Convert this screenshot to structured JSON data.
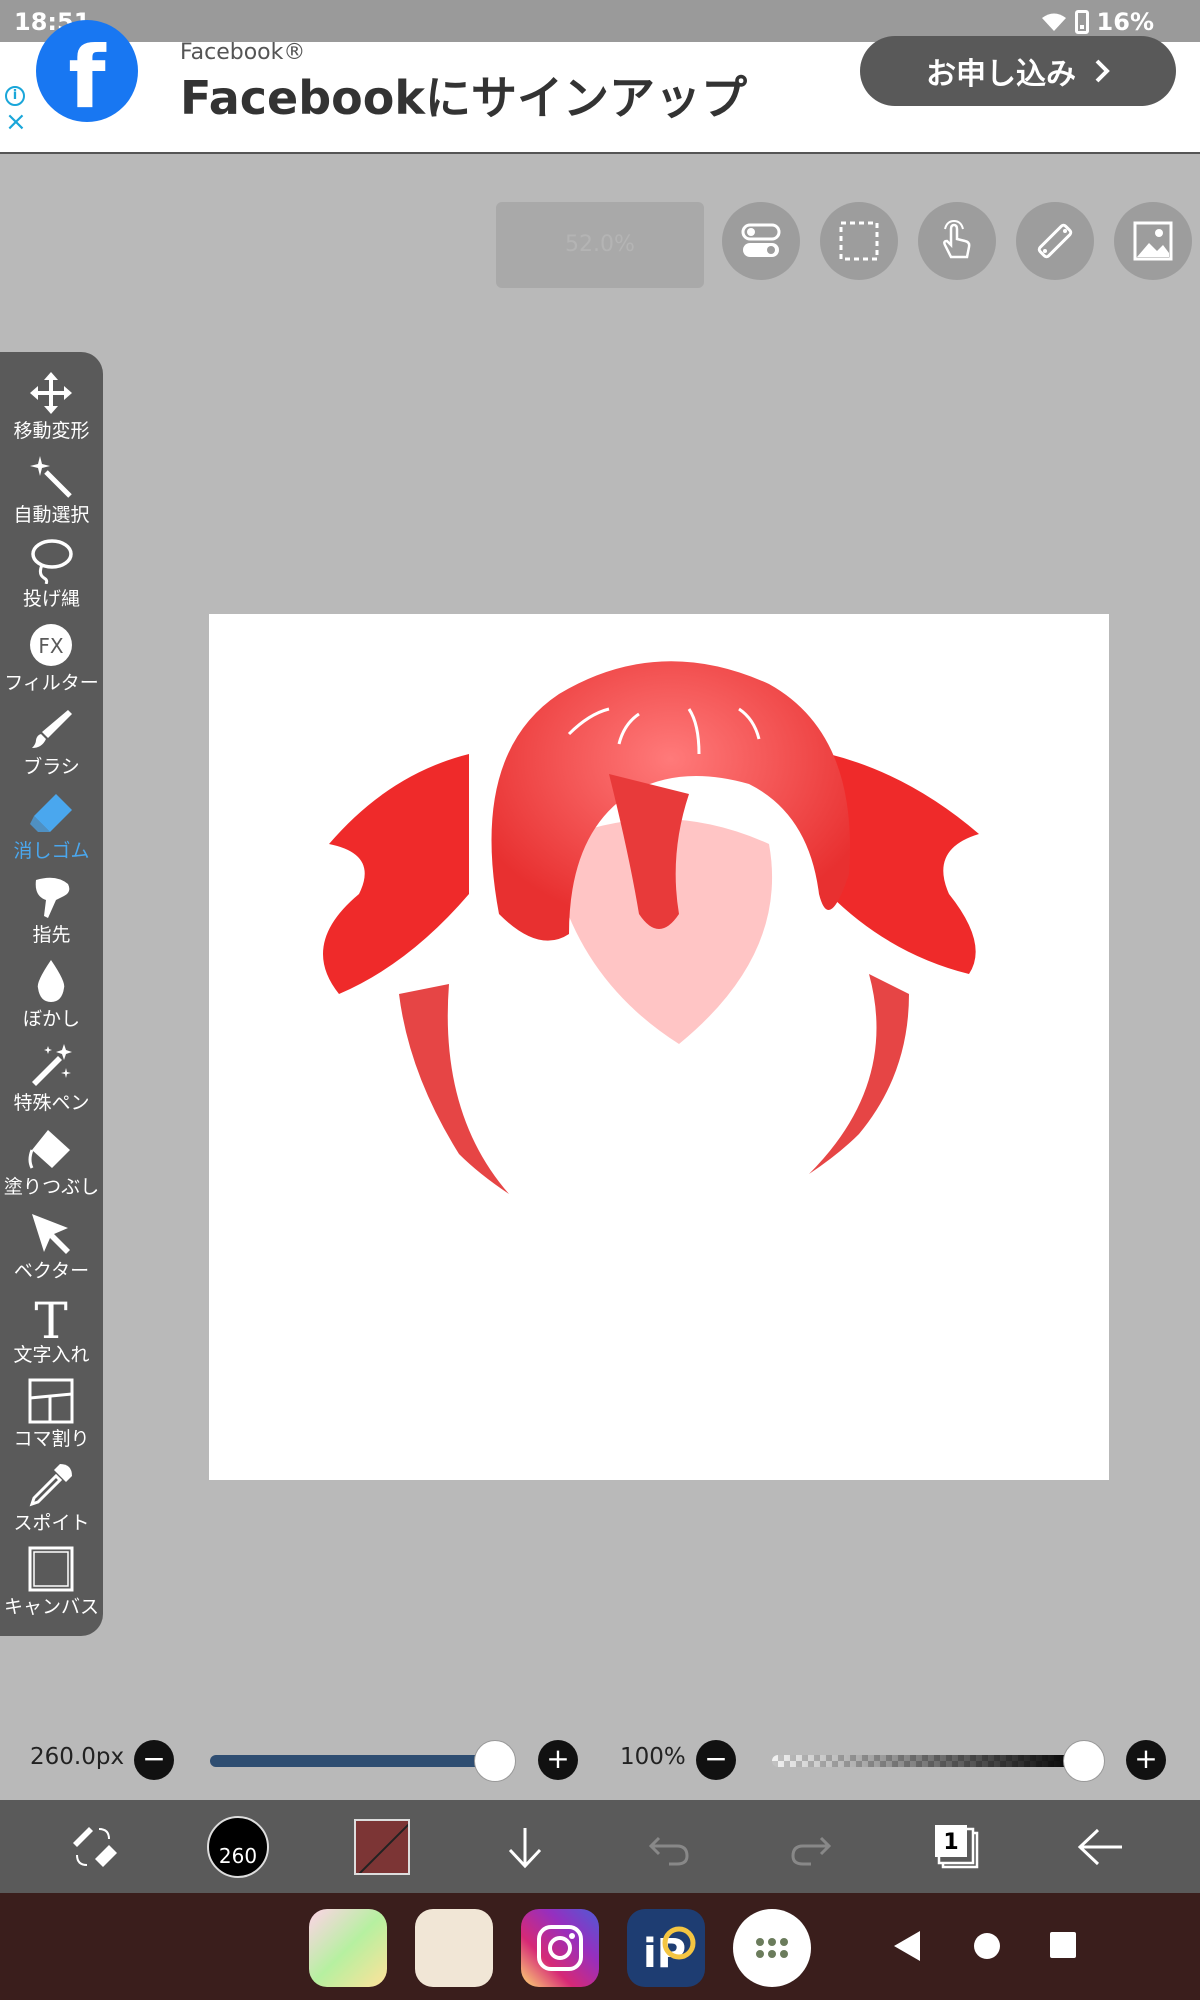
{
  "status_bar": {
    "time": "18:51",
    "battery": "16%"
  },
  "ad": {
    "brand": "Facebook®",
    "title": "Facebookにサインアップ",
    "button_label": "お申し込み",
    "info_label": "i",
    "close_label": "×"
  },
  "top_bar": {
    "zoom": "52.0%"
  },
  "tools": [
    {
      "name": "move-transform",
      "label": "移動変形"
    },
    {
      "name": "magic-wand",
      "label": "自動選択"
    },
    {
      "name": "lasso",
      "label": "投げ縄"
    },
    {
      "name": "filter",
      "label": "フィルター"
    },
    {
      "name": "brush",
      "label": "ブラシ"
    },
    {
      "name": "eraser",
      "label": "消しゴム",
      "active": true
    },
    {
      "name": "smudge",
      "label": "指先"
    },
    {
      "name": "blur",
      "label": "ぼかし"
    },
    {
      "name": "special-pen",
      "label": "特殊ペン"
    },
    {
      "name": "fill",
      "label": "塗りつぶし"
    },
    {
      "name": "vector",
      "label": "ベクター"
    },
    {
      "name": "text",
      "label": "文字入れ"
    },
    {
      "name": "frame-divider",
      "label": "コマ割り"
    },
    {
      "name": "eyedropper",
      "label": "スポイト"
    },
    {
      "name": "canvas",
      "label": "キャンバス"
    }
  ],
  "sliders": {
    "size_label": "260.0px",
    "size_fraction": 1.0,
    "opacity_label": "100%",
    "opacity_fraction": 1.0
  },
  "bottom_bar": {
    "brush_size": "260",
    "layer_count": "1"
  },
  "colors": {
    "accent_active": "#4aa7ee",
    "hair_red": "#f03a3a",
    "current_color": "#7c3535",
    "facebook_blue": "#1877f2"
  }
}
